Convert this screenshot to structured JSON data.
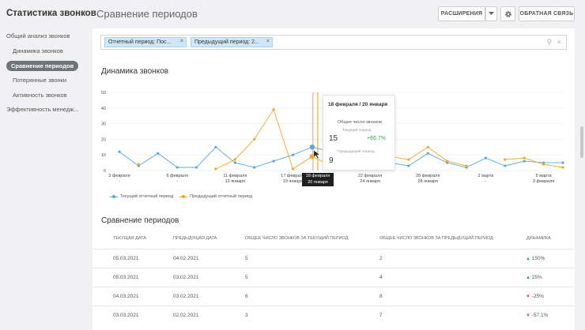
{
  "header": {
    "app_title": "Статистика звонков",
    "page_title": "Сравнение периодов",
    "extensions_label": "РАСШИРЕНИЯ",
    "feedback_label": "ОБРАТНАЯ СВЯЗЬ"
  },
  "sidebar": {
    "items": [
      {
        "label": "Общий анализ звонков"
      },
      {
        "label": "Динамика звонков"
      },
      {
        "label": "Сравнение периодов"
      },
      {
        "label": "Потерянные звонки"
      },
      {
        "label": "Активность звонков"
      },
      {
        "label": "Эффективность менедж..."
      }
    ]
  },
  "filters": {
    "chips": [
      {
        "label": "Отчетный период: Пос..."
      },
      {
        "label": "Предыдущий период: 2..."
      }
    ]
  },
  "dynamics": {
    "title": "Динамика звонков"
  },
  "tooltip": {
    "date": "18 февраля / 20 января",
    "metric": "Общее число звонков",
    "current_label": "Текущий период",
    "current_value": "15",
    "delta": "+66.7%",
    "previous_label": "Предыдущий период",
    "previous_value": "9"
  },
  "highlight": {
    "line1": "18 февраля",
    "line2": "20 января"
  },
  "legend": {
    "current": "Текущий отчетный период",
    "previous": "Предыдущий отчетный период"
  },
  "chart_data": {
    "type": "line",
    "ylim": [
      0,
      50
    ],
    "yticks": [
      0,
      10,
      20,
      30,
      40,
      50
    ],
    "x_tick_labels": [
      {
        "top": "3 февраля",
        "bottom": "-"
      },
      {
        "top": "6 февраля",
        "bottom": "-"
      },
      {
        "top": "11 февраля",
        "bottom": "13 января"
      },
      {
        "top": "17 февраля",
        "bottom": "19 января"
      },
      {
        "top": "22 февраля",
        "bottom": "24 января"
      },
      {
        "top": "26 февраля",
        "bottom": "28 января"
      },
      {
        "top": "2 марта",
        "bottom": "-"
      },
      {
        "top": "5 марта",
        "bottom": "3 февраля"
      }
    ],
    "series": [
      {
        "name": "Текущий отчетный период",
        "color": "#5aa7e0",
        "values": [
          12,
          3,
          11,
          2,
          2,
          15,
          5,
          2,
          6,
          10,
          15,
          12,
          10,
          8,
          5,
          3,
          11,
          5,
          2,
          8,
          3,
          6,
          5,
          5
        ]
      },
      {
        "name": "Предыдущий отчетный период",
        "color": "#f5a623",
        "values": [
          null,
          4,
          null,
          null,
          null,
          1,
          7,
          20,
          39,
          1,
          9,
          3,
          15,
          7,
          9,
          7,
          15,
          6,
          3,
          null,
          7,
          8,
          4,
          2
        ]
      }
    ]
  },
  "comparison": {
    "title": "Сравнение периодов",
    "columns": [
      "ТЕКУЩАЯ ДАТА",
      "ПРЕДЫДУЩАЯ ДАТА",
      "ОБЩЕЕ ЧИСЛО ЗВОНКОВ ЗА ТЕКУЩИЙ ПЕРИОД",
      "ОБЩЕЕ ЧИСЛО ЗВОНКОВ ЗА ПРЕДЫДУЩИЙ ПЕРИОД",
      "ДИНАМИКА"
    ],
    "rows": [
      {
        "cur_date": "05.03.2021",
        "prev_date": "04.02.2021",
        "cur_total": "5",
        "prev_total": "2",
        "trend": "up",
        "dynamics": "150%"
      },
      {
        "cur_date": "05.03.2021",
        "prev_date": "03.02.2021",
        "cur_total": "5",
        "prev_total": "4",
        "trend": "up",
        "dynamics": "25%"
      },
      {
        "cur_date": "04.03.2021",
        "prev_date": "03.02.2021",
        "cur_total": "6",
        "prev_total": "8",
        "trend": "down",
        "dynamics": "-25%"
      },
      {
        "cur_date": "03.03.2021",
        "prev_date": "02.02.2021",
        "cur_total": "3",
        "prev_total": "7",
        "trend": "down",
        "dynamics": "-57.1%"
      }
    ]
  }
}
